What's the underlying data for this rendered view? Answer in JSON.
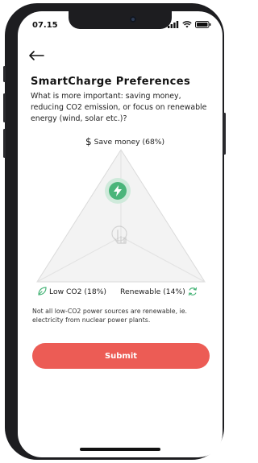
{
  "status_bar": {
    "time": "07.15"
  },
  "header": {
    "back_icon": "arrow-left-icon",
    "title": "SmartCharge Preferences",
    "question": "What is more important: saving money, reducing CO2 emission, or focus on renewable energy (wind, solar etc.)?"
  },
  "preferences": {
    "save_money": {
      "icon": "dollar-icon",
      "label": "Save money (68%)",
      "value": 68
    },
    "low_co2": {
      "icon": "leaf-icon",
      "label": "Low CO2 (18%)",
      "value": 18
    },
    "renewable": {
      "icon": "recycle-icon",
      "label": "Renewable (14%)",
      "value": 14
    },
    "handle_icon": "lightning-icon",
    "hint_icon": "hand-pointer-icon"
  },
  "note": "Not all low-CO2 power sources are renewable, ie. electricity from nuclear power plants.",
  "submit_label": "Submit",
  "colors": {
    "accent_green": "#4ab57a",
    "submit_red": "#ec5c55"
  }
}
